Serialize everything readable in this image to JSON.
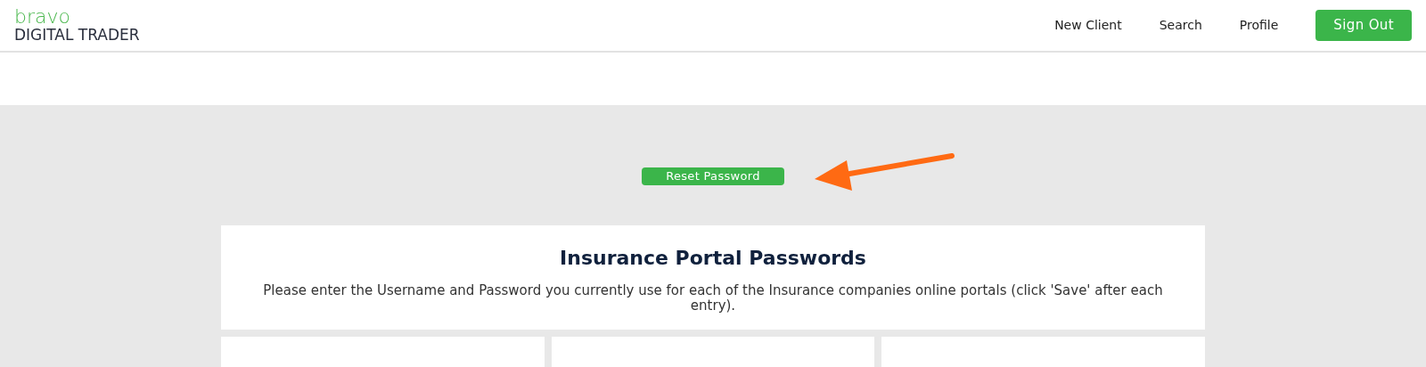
{
  "logo": {
    "brand": "bravo",
    "product": "DIGITAL TRADER"
  },
  "nav": [
    {
      "label": "New Client",
      "kind": "link"
    },
    {
      "label": "Search",
      "kind": "link"
    },
    {
      "label": "Profile",
      "kind": "link"
    },
    {
      "label": "Sign Out",
      "kind": "button"
    }
  ],
  "reset_button": "Reset Password",
  "portal_card": {
    "title": "Insurance Portal Passwords",
    "description": "Please enter the Username and Password you currently use for each of the Insurance companies online portals (click 'Save' after each entry)."
  }
}
